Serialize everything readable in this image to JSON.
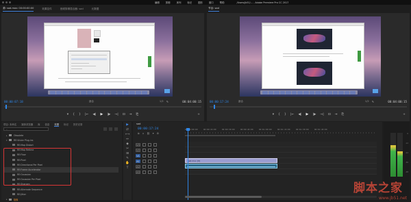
{
  "menubar": {
    "items": [
      "编辑",
      "剪辑",
      "序列",
      "标记",
      "图形",
      "窗口",
      "帮助"
    ],
    "title": "/Users/jb51/... - Adobe Premiere Pro CC 2017"
  },
  "left_monitor": {
    "tabs": [
      "源: 无剪辑",
      "效果控件",
      "音频剪辑混合器: sad",
      "元数据"
    ],
    "active_tab": "源: sad.mov: 00:00:00:00",
    "timecode": "00:00:07:18",
    "fit": "适合",
    "ratio": "1/2",
    "duration": "00:04:00:15"
  },
  "right_monitor": {
    "tab": "节目: sad",
    "timecode": "00:00:17:24",
    "fit": "适合",
    "ratio": "1/2",
    "duration": "00:04:00:15"
  },
  "transport": {
    "left": [
      "▾",
      "{",
      "}",
      "|←",
      "◀|",
      "▶",
      "|▶",
      "→|",
      "⊡",
      "⇥",
      "⎗"
    ],
    "right": [
      "▾",
      "{",
      "}",
      "|←",
      "◀|",
      "▶",
      "|▶",
      "→|",
      "⊡",
      "⇥",
      "⎘"
    ],
    "add": "+"
  },
  "project_panel": {
    "tabs": [
      "项目: 未命名",
      "媒体浏览器",
      "库",
      "信息",
      "效果",
      "标记",
      "历史记录"
    ],
    "active_tab": "效果",
    "search_placeholder": "",
    "tree": [
      {
        "label": "Obsolete",
        "level": 1,
        "type": "folder"
      },
      {
        "label": "RE:Vision Plug-ins",
        "level": 1,
        "type": "folder-open"
      },
      {
        "label": "RE:Map Distort",
        "level": 2,
        "type": "fx"
      },
      {
        "label": "RE:Map Retime",
        "level": 2,
        "type": "fx"
      },
      {
        "label": "RE:Flow",
        "level": 2,
        "type": "fx"
      },
      {
        "label": "RE:Pixel",
        "level": 2,
        "type": "fx"
      },
      {
        "label": "RE:Directional Per Pixel",
        "level": 2,
        "type": "fx"
      },
      {
        "label": "RE:Frame Accelerator",
        "level": 2,
        "type": "fx"
      },
      {
        "label": "RE:Gaussian",
        "level": 2,
        "type": "fx"
      },
      {
        "label": "RE:Gaussian Per Pixel",
        "level": 2,
        "type": "fx"
      },
      {
        "label": "RE:Sharpen",
        "level": 2,
        "type": "fx"
      },
      {
        "label": "RE:Alternate Sequence",
        "level": 2,
        "type": "fx"
      },
      {
        "label": "RE:Jitter",
        "level": 2,
        "type": "fx"
      },
      {
        "label": "抠像",
        "level": 1,
        "type": "folder"
      },
      {
        "label": "视频效果",
        "level": 1,
        "type": "folder"
      }
    ],
    "selected_index": 7
  },
  "tools": [
    "▶",
    "⇄",
    "⟷",
    "↔",
    "◆",
    "✂",
    "⊞",
    "✎",
    "✋",
    "T"
  ],
  "timeline": {
    "tab": "sad",
    "timecode": "00:00:17:24",
    "ruler": [
      "00:00:00:00",
      "00:00:15:00",
      "00:00:30:00",
      "00:00:45:00",
      "00:01:00:00",
      "00:01:15:00",
      "00:01:30:00",
      "00:01:45:00"
    ],
    "tracks": [
      {
        "id": "V3",
        "blue": false
      },
      {
        "id": "V2",
        "blue": false
      },
      {
        "id": "V1",
        "blue": true
      },
      {
        "id": "A1",
        "blue": true
      },
      {
        "id": "A2",
        "blue": false
      },
      {
        "id": "A3",
        "blue": false
      }
    ],
    "video_clip": "sad.mov [V]"
  },
  "meters": {
    "levels": [
      0.72,
      0.58
    ],
    "db_labels": [
      "0",
      "-12",
      "-24",
      "-36",
      "-48"
    ]
  },
  "watermark": {
    "text": "脚本之家",
    "url": "www.jb51.net"
  },
  "colors": {
    "accent_blue": "#2f86e6",
    "highlight_red": "#d83636",
    "watermark_red": "#d04a3a",
    "video_clip": "#9b9ccf",
    "audio_clip": "#2b6a8b"
  }
}
